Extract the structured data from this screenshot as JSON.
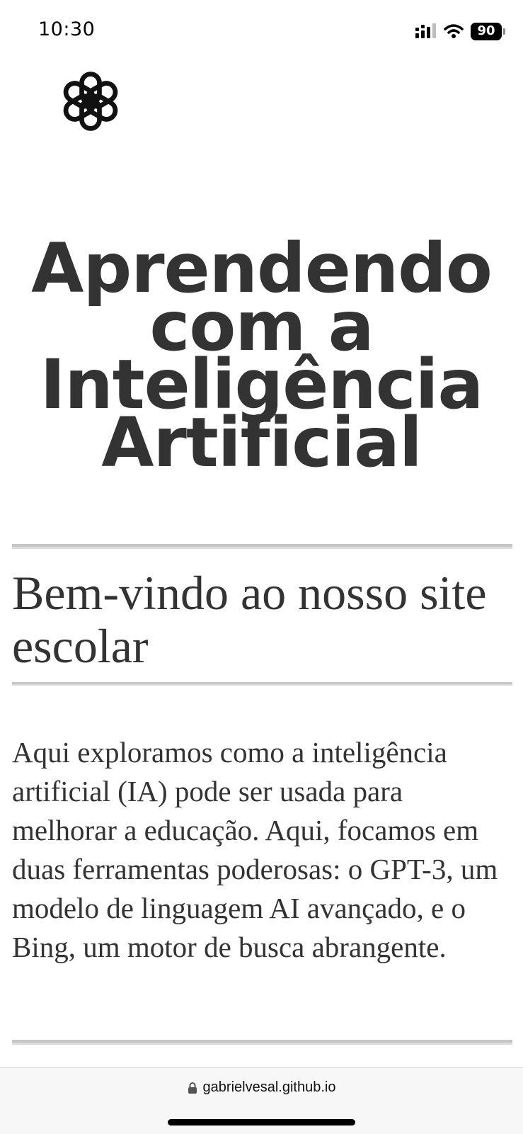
{
  "status_bar": {
    "time": "10:30",
    "battery": "90",
    "icons": [
      "signal-icon",
      "wifi-icon",
      "battery-icon"
    ]
  },
  "header": {
    "logo_icon": "openai-logo-icon",
    "title": "Aprendendo com a Inteligência Artificial"
  },
  "main": {
    "heading": "Bem-vindo ao nosso site escolar",
    "paragraph": "Aqui exploramos como a inteligência artificial (IA) pode ser usada para melhorar a educação. Aqui, focamos em duas ferramentas poderosas: o GPT-3, um modelo de linguagem AI avançado, e o Bing, um motor de busca abrangente."
  },
  "browser": {
    "url": "gabrielvesal.github.io",
    "lock_icon": "lock-icon"
  },
  "colors": {
    "text": "#333333",
    "rule": "#c6c6c6",
    "background": "#ffffff"
  }
}
